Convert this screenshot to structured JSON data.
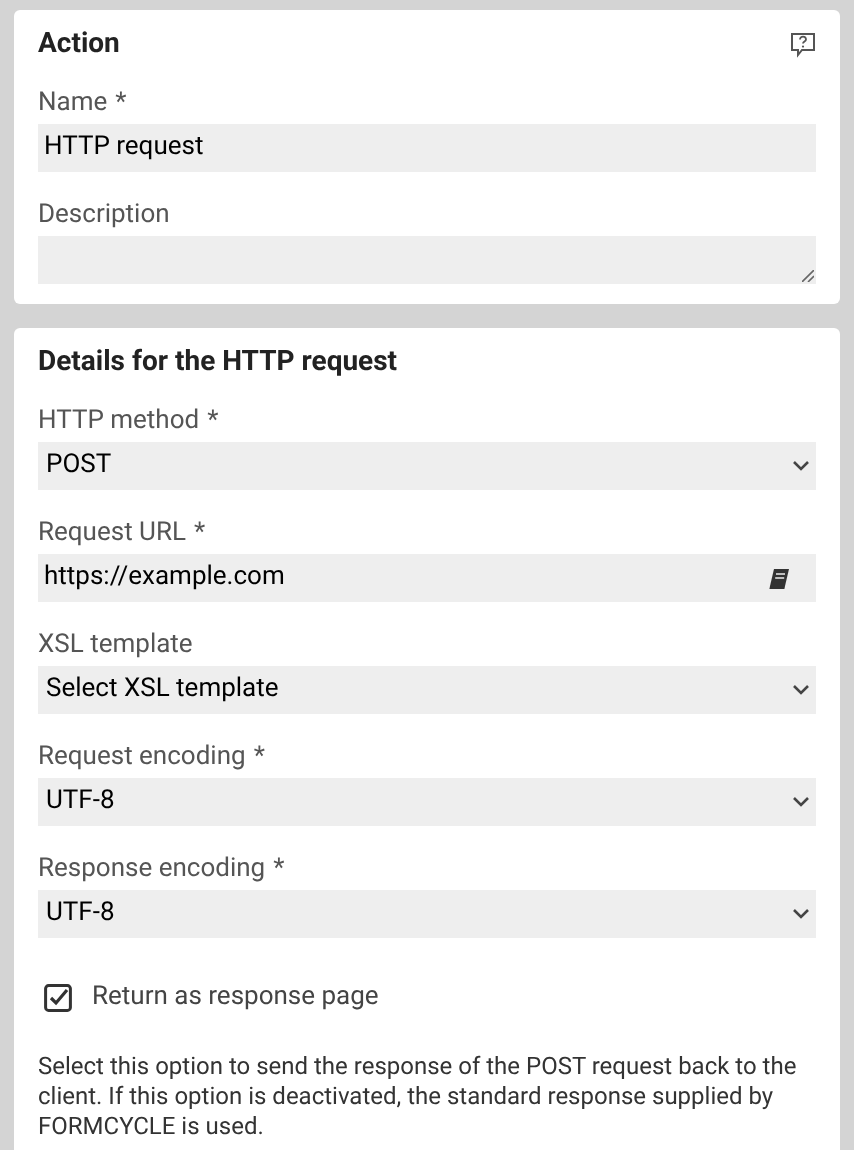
{
  "sections": [
    {
      "title": "Action",
      "help": true,
      "fields": [
        {
          "kind": "text",
          "label": "Name",
          "mark": "*",
          "value": "HTTP request"
        },
        {
          "kind": "textarea",
          "label": "Description"
        }
      ]
    },
    {
      "title": "Details for the HTTP request",
      "fields": [
        {
          "kind": "select",
          "label": "HTTP method",
          "mark": "*",
          "value": "POST"
        },
        {
          "kind": "lookup",
          "label": "Request URL",
          "mark": "*",
          "value": "https://example.com"
        },
        {
          "kind": "select",
          "label": "XSL template",
          "value": "Select XSL template"
        },
        {
          "kind": "select",
          "label": "Request encoding",
          "mark": "*",
          "value": "UTF-8"
        },
        {
          "kind": "select",
          "label": "Response encoding",
          "mark": "*",
          "value": "UTF-8"
        }
      ],
      "checkbox": {
        "label": "Return as response page",
        "checked": true
      },
      "help_text": "Select this option to send the response of the POST request back to the client. If this option is deactivated, the standard response supplied by FORMCYCLE is used."
    }
  ]
}
